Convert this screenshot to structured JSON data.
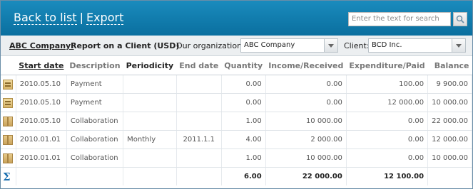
{
  "header": {
    "back_label": "Back to list",
    "separator": "|",
    "export_label": "Export",
    "search_placeholder": "Enter the text for search"
  },
  "toolbar": {
    "company": "ABC Company:",
    "report_title": "Report on a Client (USD)",
    "org_label": "Our organization:",
    "org_value": "ABC Company",
    "client_label": "Client:",
    "client_value": "BCD Inc."
  },
  "table": {
    "columns": [
      "Start date",
      "Description",
      "Periodicity",
      "End date",
      "Quantity",
      "Income/Received",
      "Expenditure/Paid",
      "Balance"
    ],
    "rows": [
      {
        "icon": "payment-icon",
        "start": "2010.05.10",
        "desc": "Payment",
        "period": "",
        "end": "",
        "qty": "0.00",
        "income": "0.00",
        "exp": "100.00",
        "bal": "9 900.00"
      },
      {
        "icon": "payment-icon",
        "start": "2010.05.10",
        "desc": "Payment",
        "period": "",
        "end": "",
        "qty": "0.00",
        "income": "0.00",
        "exp": "12 000.00",
        "bal": "10 000.00"
      },
      {
        "icon": "box-icon",
        "start": "2010.05.10",
        "desc": "Collaboration",
        "period": "",
        "end": "",
        "qty": "1.00",
        "income": "10 000.00",
        "exp": "0.00",
        "bal": "22 000.00"
      },
      {
        "icon": "box-icon",
        "start": "2010.01.01",
        "desc": "Collaboration",
        "period": "Monthly",
        "end": "2011.1.1",
        "qty": "4.00",
        "income": "2 000.00",
        "exp": "0.00",
        "bal": "12 000.00"
      },
      {
        "icon": "box-icon",
        "start": "2010.01.01",
        "desc": "Collaboration",
        "period": "",
        "end": "",
        "qty": "1.00",
        "income": "10 000.00",
        "exp": "0.00",
        "bal": "10 000.00"
      }
    ],
    "totals": {
      "symbol": "Σ",
      "qty": "6.00",
      "income": "22 000.00",
      "exp": "12 100.00"
    }
  }
}
